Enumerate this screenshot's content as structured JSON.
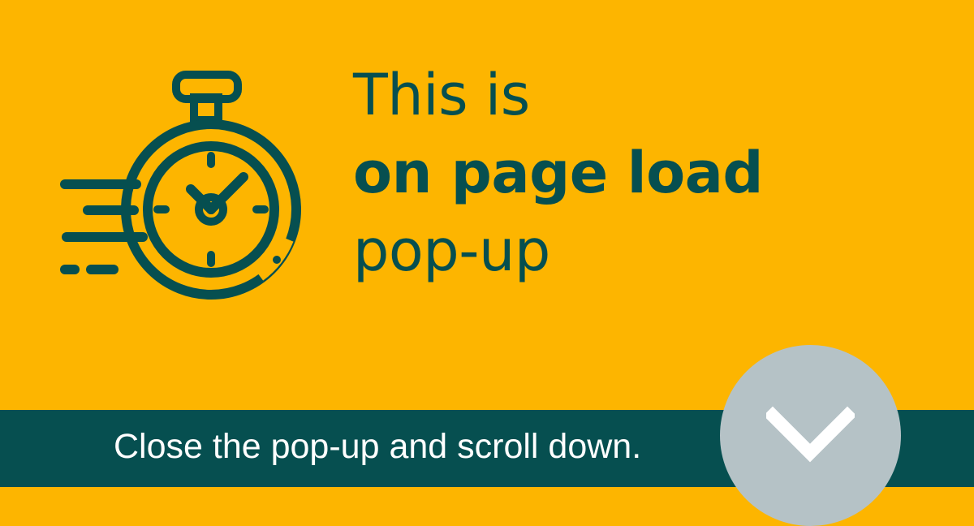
{
  "banner": {
    "headline": {
      "line1": "This is",
      "line2": "on page load",
      "line3": "pop-up"
    },
    "icon": "stopwatch-icon"
  },
  "footer": {
    "message": "Close the pop-up and scroll down.",
    "action_icon": "chevron-down-icon"
  },
  "colors": {
    "background": "#fdb500",
    "accent": "#064f50",
    "button": "#b5c2c6",
    "text_light": "#ffffff"
  }
}
